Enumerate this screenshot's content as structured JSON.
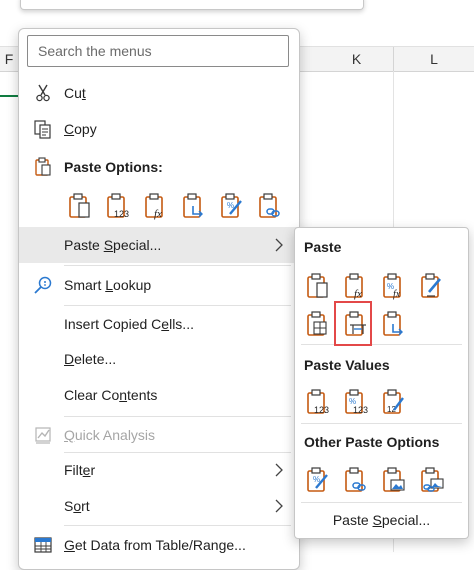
{
  "sheet": {
    "columns": [
      "F",
      "K",
      "L"
    ]
  },
  "search": {
    "placeholder": "Search the menus"
  },
  "menu": {
    "cut": {
      "pre": "Cu",
      "ul": "t",
      "post": ""
    },
    "copy": {
      "pre": "",
      "ul": "C",
      "post": "opy"
    },
    "paste_options": "Paste Options:",
    "paste_special": {
      "pre": "Paste ",
      "ul": "S",
      "post": "pecial..."
    },
    "smart_lookup": {
      "pre": "Smart ",
      "ul": "L",
      "post": "ookup"
    },
    "insert_copied": {
      "pre": "Insert Copied C",
      "ul": "e",
      "post": "lls..."
    },
    "delete": {
      "pre": "",
      "ul": "D",
      "post": "elete..."
    },
    "clear_contents": {
      "pre": "Clear Co",
      "ul": "n",
      "post": "tents"
    },
    "quick_analysis": {
      "pre": "",
      "ul": "Q",
      "post": "uick Analysis"
    },
    "filter": {
      "pre": "Filt",
      "ul": "e",
      "post": "r"
    },
    "sort": {
      "pre": "S",
      "ul": "o",
      "post": "rt"
    },
    "get_data": {
      "pre": "",
      "ul": "G",
      "post": "et Data from Table/Range..."
    }
  },
  "submenu": {
    "paste_heading": "Paste",
    "paste_values_heading": "Paste Values",
    "other_heading": "Other Paste Options",
    "paste_special_link": {
      "pre": "Paste ",
      "ul": "S",
      "post": "pecial..."
    }
  },
  "icons": {
    "paste_options": [
      "paste-icon",
      "paste-values-123-icon",
      "paste-formulas-fx-icon",
      "paste-transpose-icon",
      "paste-formatting-icon",
      "paste-link-icon"
    ],
    "submenu_paste": [
      "paste-icon",
      "paste-formulas-fx-icon",
      "paste-formulas-number-format-icon",
      "paste-keep-source-formatting-icon",
      "paste-no-borders-icon",
      "paste-keep-column-widths-icon",
      "paste-transpose-icon"
    ],
    "submenu_values": [
      "paste-values-123-icon",
      "paste-values-number-format-icon",
      "paste-values-source-formatting-icon"
    ],
    "submenu_other": [
      "paste-formatting-icon",
      "paste-link-icon",
      "paste-picture-icon",
      "paste-linked-picture-icon"
    ]
  },
  "colors": {
    "clipboard": "#c55a11",
    "clipboard_fill": "#ffffff",
    "accent_blue": "#2b79d0",
    "highlight": "#e34848",
    "hover": "#e9e9e9"
  }
}
